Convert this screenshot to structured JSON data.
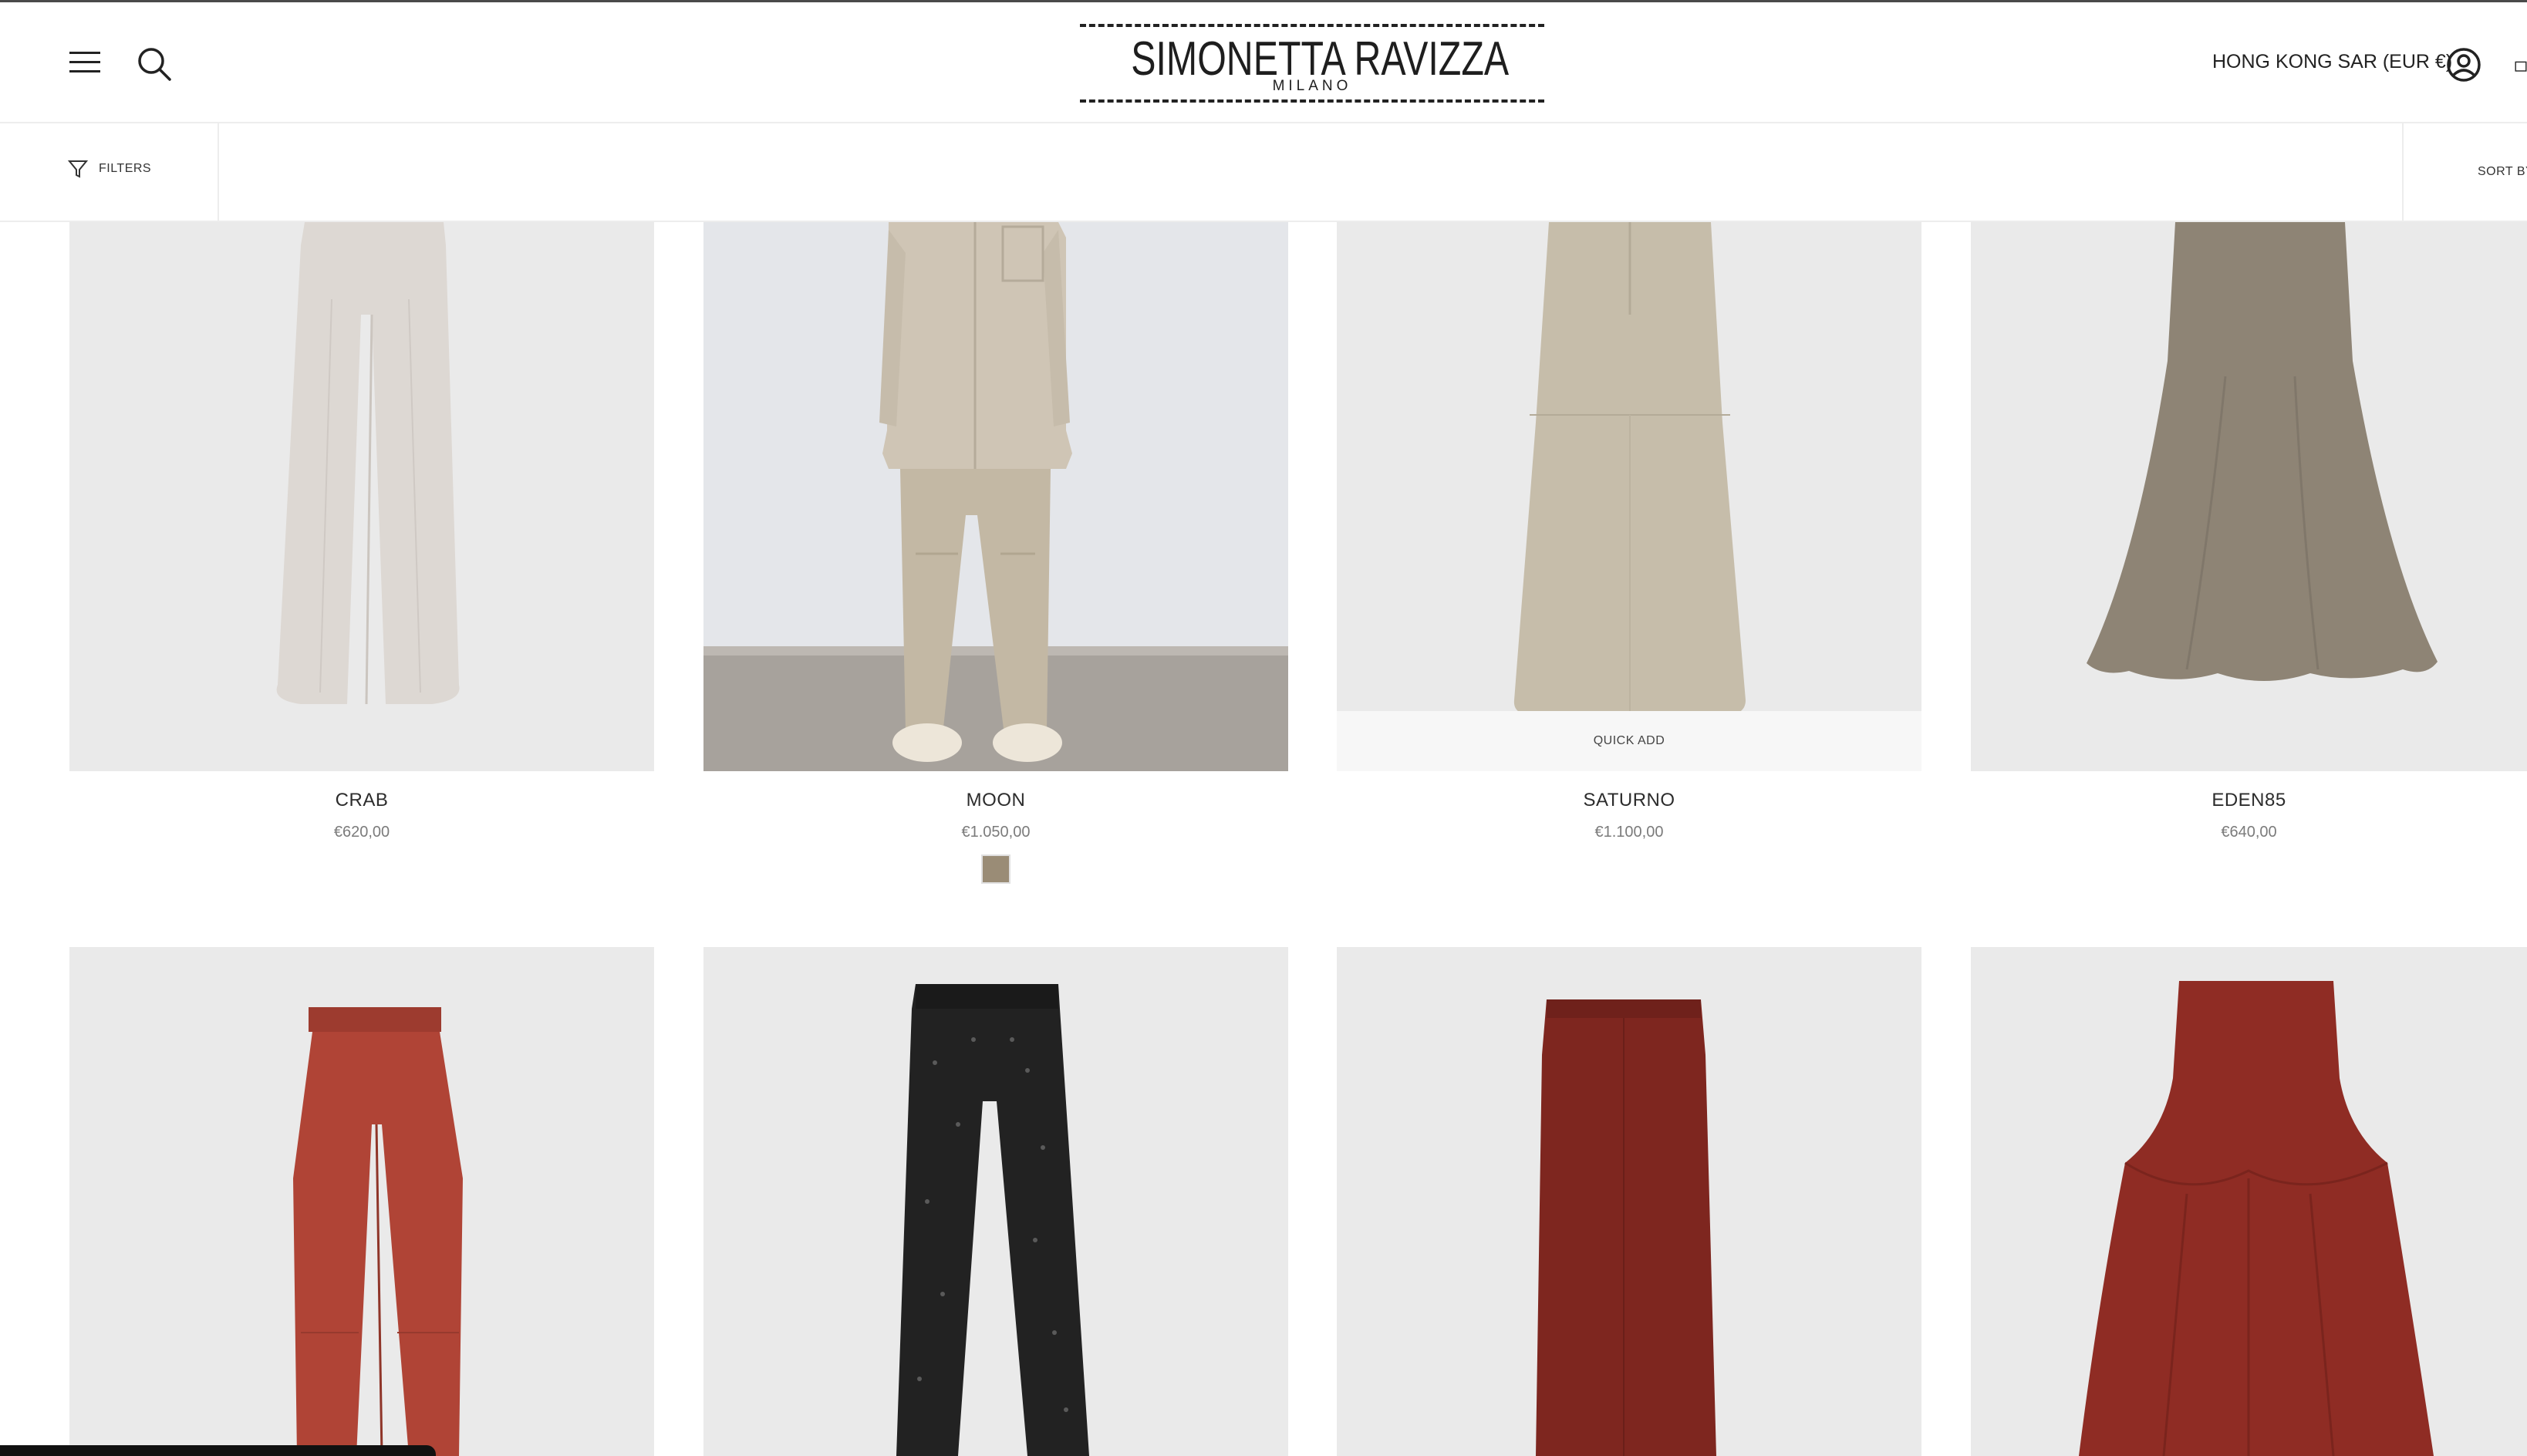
{
  "header": {
    "logo_name": "SIMONETTA RAVIZZA",
    "logo_sub": "MILANO",
    "region": "HONG KONG SAR (EUR €)",
    "icons": [
      "menu-icon",
      "search-icon",
      "account-icon",
      "cart-icon"
    ]
  },
  "toolbar": {
    "filters_label": "FILTERS",
    "sort_label": "SORT BY"
  },
  "products": [
    {
      "name": "CRAB",
      "price": "€620,00"
    },
    {
      "name": "MOON",
      "price": "€1.050,00",
      "swatch_color": "#9a8c76"
    },
    {
      "name": "SATURNO",
      "price": "€1.100,00",
      "quick_add": "QUICK ADD"
    },
    {
      "name": "EDEN85",
      "price": "€640,00"
    },
    {
      "name": "",
      "price": ""
    },
    {
      "name": "",
      "price": ""
    },
    {
      "name": "",
      "price": ""
    },
    {
      "name": "",
      "price": ""
    }
  ],
  "colors": {
    "card_bg": "#e9e9ea",
    "text": "#2c2c2c",
    "price": "#7b7b7b",
    "rust": "#8b2e25"
  }
}
